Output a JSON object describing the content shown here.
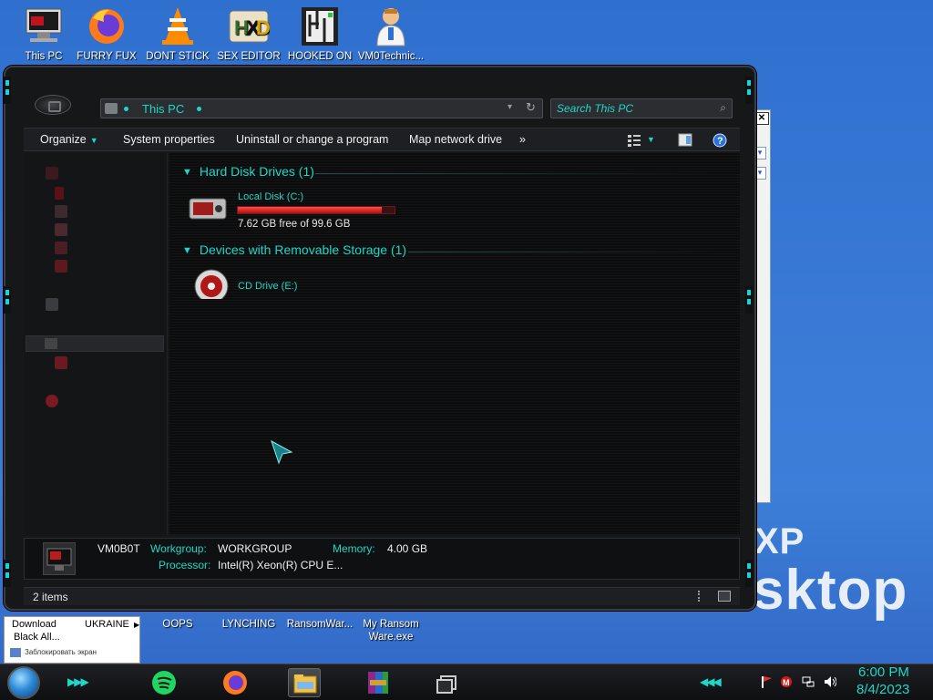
{
  "desktop_icons": [
    {
      "label": "This PC",
      "icon": "computer-icon"
    },
    {
      "label": "FURRY FUX",
      "icon": "firefox-icon"
    },
    {
      "label": "DONT STICK",
      "icon": "vlc-cone-icon"
    },
    {
      "label": "SEX EDITOR",
      "icon": "hxd-icon"
    },
    {
      "label": "HOOKED ON",
      "icon": "maze-icon"
    },
    {
      "label": "VM0Technic...",
      "icon": "doctor-icon"
    }
  ],
  "bottom_desktop_icons": [
    {
      "label": "OOPS"
    },
    {
      "label": "LYNCHING"
    },
    {
      "label": "RansomWar..."
    },
    {
      "label": "My Ransom Ware.exe"
    }
  ],
  "watermark": {
    "line1": "XP",
    "line2": "sktop"
  },
  "explorer": {
    "address": {
      "path": "This PC"
    },
    "search": {
      "placeholder": "Search This PC"
    },
    "toolbar": {
      "organize": "Organize",
      "system_properties": "System properties",
      "uninstall": "Uninstall or change a program",
      "map_drive": "Map network drive",
      "more": "»"
    },
    "groups": [
      {
        "header": "Hard Disk Drives (1)"
      },
      {
        "header": "Devices with Removable Storage (1)"
      }
    ],
    "drives": [
      {
        "name": "Local Disk (C:)",
        "free": "7.62 GB free of 99.6 GB",
        "used_fraction": 0.92
      },
      {
        "name": "CD Drive (E:)"
      }
    ],
    "details": {
      "computer_name": "VM0B0T",
      "workgroup_label": "Workgroup:",
      "workgroup_value": "WORKGROUP",
      "memory_label": "Memory:",
      "memory_value": "4.00 GB",
      "processor_label": "Processor:",
      "processor_value": "Intel(R) Xeon(R) CPU E..."
    },
    "status": {
      "count": "2 items"
    }
  },
  "popup": {
    "line1": "Download",
    "line2": "Black All...",
    "line3": "UKRAINE",
    "line4": "Заблокировать экран"
  },
  "taskbar": {
    "time": "6:00 PM",
    "date": "8/4/2023"
  },
  "colors": {
    "accent": "#1ed7c8",
    "bar_fill": "#d11a1a",
    "desktop": "#3a7ad6"
  }
}
